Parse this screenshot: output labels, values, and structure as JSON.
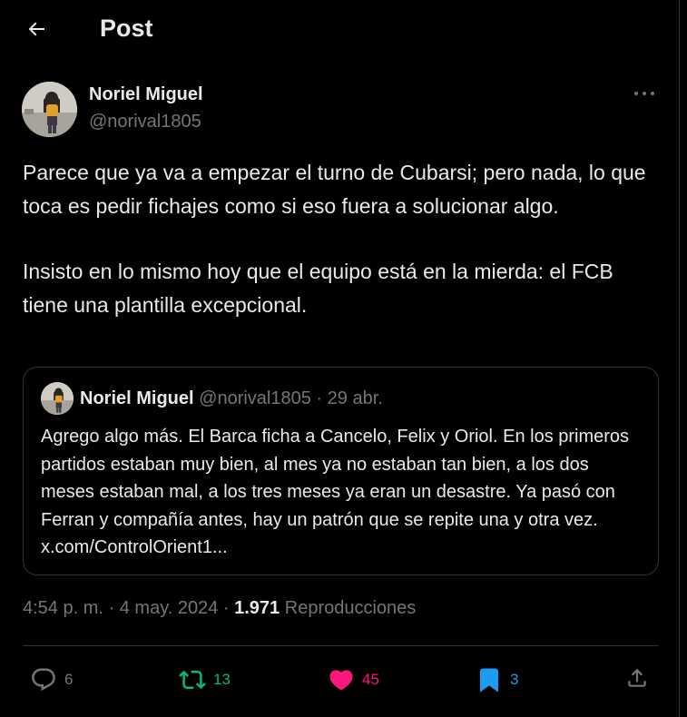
{
  "header": {
    "title": "Post",
    "back_icon": "arrow-left-icon"
  },
  "post": {
    "author": {
      "name": "Noriel Miguel",
      "handle": "@norival1805",
      "avatar_icon": "user-avatar"
    },
    "more_icon": "more-horizontal-icon",
    "text_paragraphs": [
      "Parece que ya va a empezar el turno de Cubarsi; pero nada, lo que toca es pedir fichajes como si eso fuera a solucionar algo.",
      "Insisto en lo mismo hoy que el equipo está en la mierda: el FCB tiene una plantilla excepcional."
    ],
    "quote": {
      "name": "Noriel Miguel",
      "handle": "@norival1805",
      "separator": "·",
      "date": "29 abr.",
      "text": "Agrego algo más. El Barca ficha a Cancelo, Felix y Oriol. En los primeros partidos estaban muy bien, al mes ya no estaban tan bien, a los dos meses estaban mal, a los tres meses ya eran un desastre. Ya pasó con Ferran y compañía antes, hay un patrón que se repite una y otra vez. x.com/ControlOrient1..."
    },
    "meta": {
      "time": "4:54 p. m.",
      "separator": "·",
      "date": "4 may. 2024",
      "separator2": "·",
      "views_count": "1.971",
      "views_label": "Reproducciones"
    },
    "actions": {
      "replies": {
        "count": "6",
        "icon": "reply-icon",
        "color": "#71767b"
      },
      "reposts": {
        "count": "13",
        "icon": "repost-icon",
        "color": "#00ba7c"
      },
      "likes": {
        "count": "45",
        "icon": "heart-filled-icon",
        "color": "#f91880"
      },
      "bookmarks": {
        "count": "3",
        "icon": "bookmark-filled-icon",
        "color": "#1d9bf0"
      },
      "share": {
        "icon": "share-icon",
        "color": "#1d9bf0"
      }
    }
  },
  "colors": {
    "background": "#000000",
    "text": "#e7e9ea",
    "muted": "#71767b",
    "border": "#2f3336"
  }
}
